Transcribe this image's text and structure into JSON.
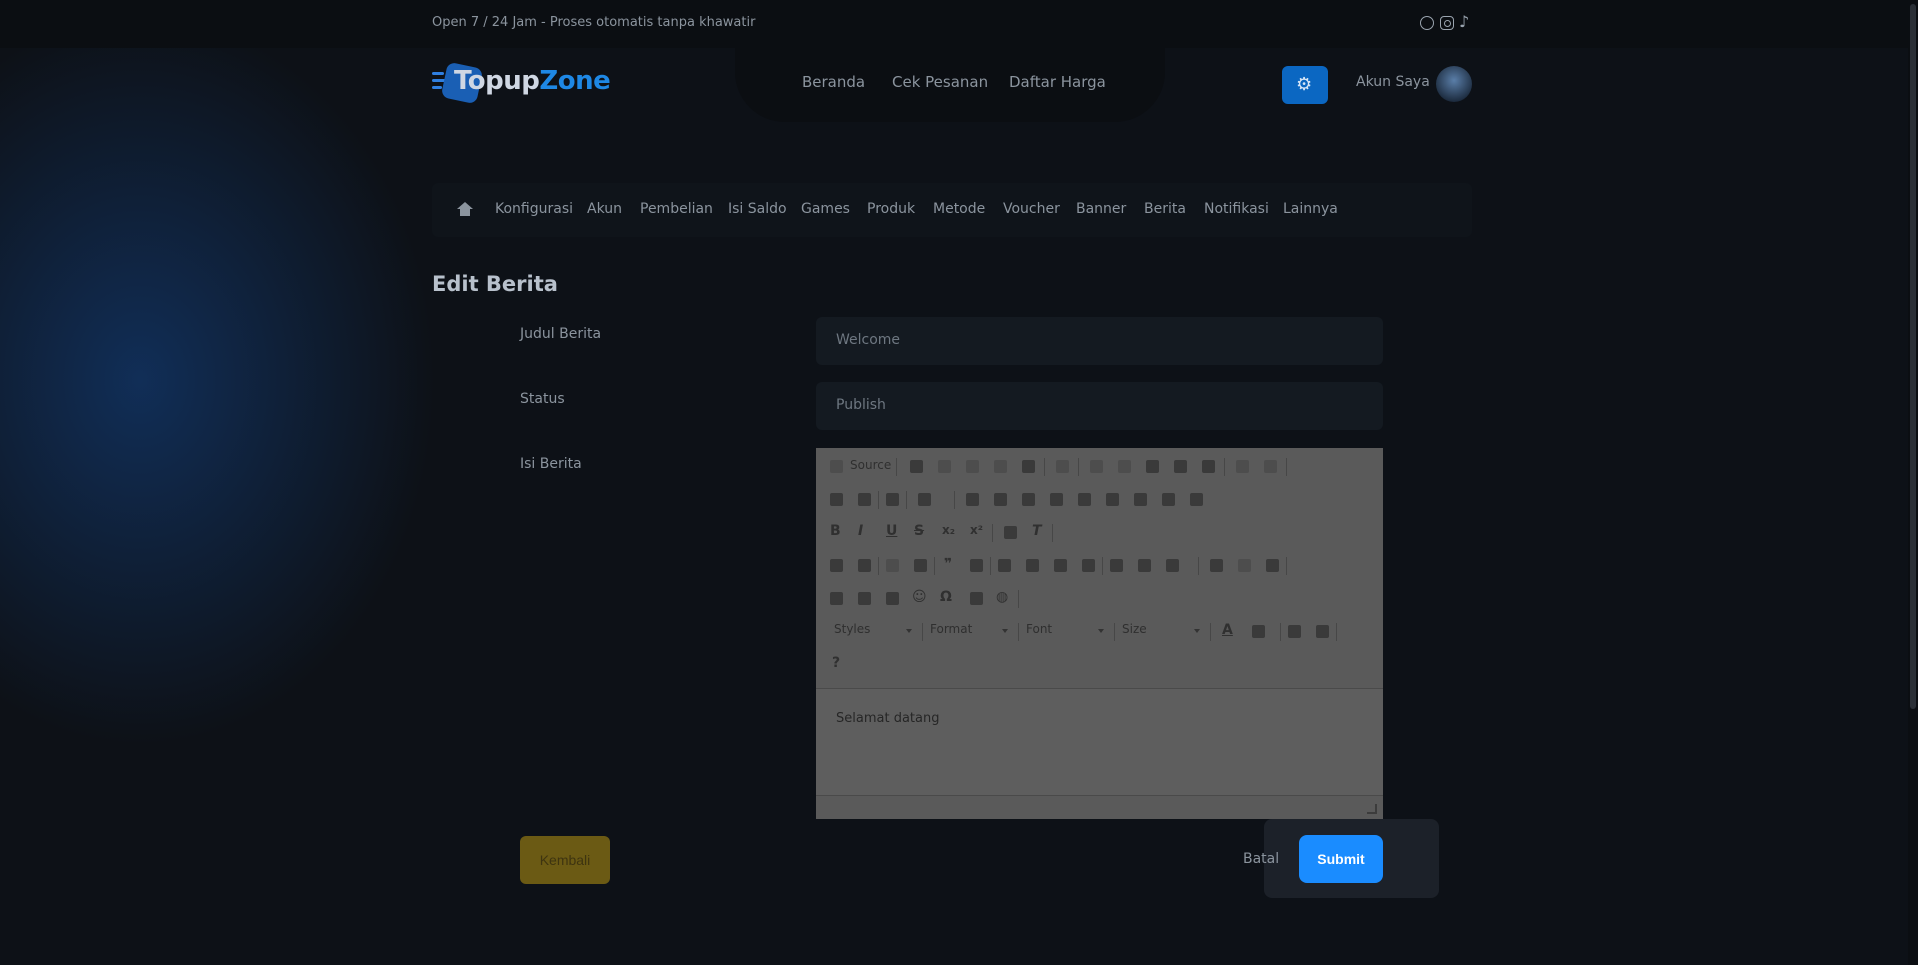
{
  "topbar": {
    "text": "Open 7 / 24 Jam - Proses otomatis tanpa khawatir"
  },
  "logo": {
    "part1": "Topup",
    "part2": "Z",
    "part3": "one"
  },
  "nav": {
    "items": [
      "Beranda",
      "Cek Pesanan",
      "Daftar Harga"
    ]
  },
  "user": {
    "label": "Akun Saya"
  },
  "admin_menu": {
    "items": [
      "Konfigurasi",
      "Akun",
      "Pembelian",
      "Isi Saldo",
      "Games",
      "Produk",
      "Metode",
      "Voucher",
      "Banner",
      "Berita",
      "Notifikasi",
      "Lainnya"
    ]
  },
  "page": {
    "title": "Edit Berita"
  },
  "form": {
    "judul_label": "Judul Berita",
    "judul_value": "Welcome",
    "status_label": "Status",
    "status_value": "Publish",
    "isi_label": "Isi Berita"
  },
  "editor": {
    "source_label": "Source",
    "styles_label": "Styles",
    "format_label": "Format",
    "font_label": "Font",
    "size_label": "Size",
    "content": "Selamat datang",
    "help_glyph": "?"
  },
  "actions": {
    "back_label": "Kembali",
    "cancel_label": "Batal",
    "submit_label": "Submit"
  }
}
